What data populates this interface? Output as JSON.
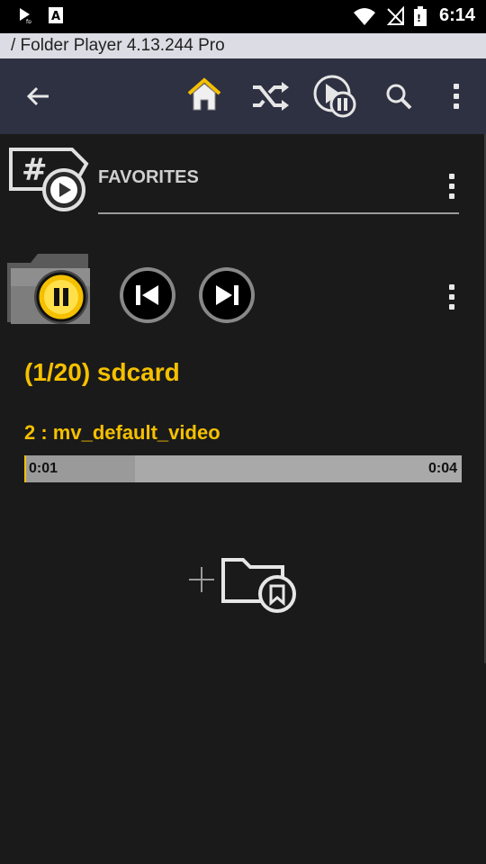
{
  "status_bar": {
    "time": "6:14",
    "icons": [
      "play-notification-icon",
      "font-a-icon",
      "wifi-icon",
      "no-sim-icon",
      "battery-icon"
    ]
  },
  "title_bar": {
    "text": "/ Folder Player 4.13.244  Pro"
  },
  "toolbar": {
    "icons": [
      "back-arrow-icon",
      "home-icon",
      "shuffle-icon",
      "play-pause-mode-icon",
      "search-icon",
      "overflow-menu-icon"
    ],
    "accent": "#f5c000"
  },
  "favorites": {
    "label": "FAVORITES"
  },
  "player": {
    "folder_label": "(1/20)  sdcard",
    "track_label": "2 : mv_default_video",
    "elapsed": "0:01",
    "duration": "0:04",
    "progress_fraction": 0.25
  },
  "colors": {
    "accent": "#f5c000",
    "toolbar": "#2e3142",
    "background": "#1a1a1a"
  }
}
